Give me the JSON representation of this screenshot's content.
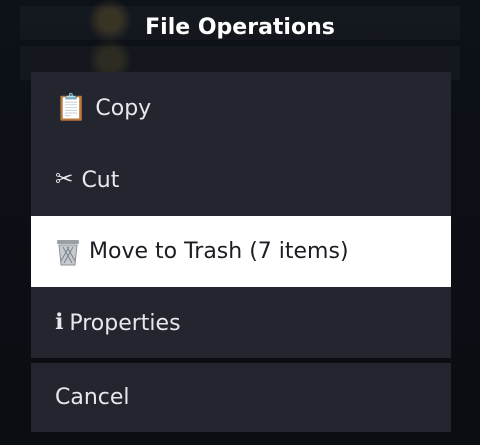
{
  "dialog": {
    "title": "File Operations"
  },
  "menu": {
    "items": [
      {
        "label": "Copy",
        "icon": "clipboard-icon"
      },
      {
        "label": "Cut",
        "icon": "scissors-icon"
      },
      {
        "label": "Move to Trash (7 items)",
        "icon": "trash-icon",
        "selected": true
      },
      {
        "label": "Properties",
        "icon": "info-icon"
      }
    ],
    "cancel_label": "Cancel"
  },
  "colors": {
    "panel": "#23262f",
    "selected": "#ffffff",
    "text": "#e6e8ec",
    "background": "#0b0e13"
  }
}
